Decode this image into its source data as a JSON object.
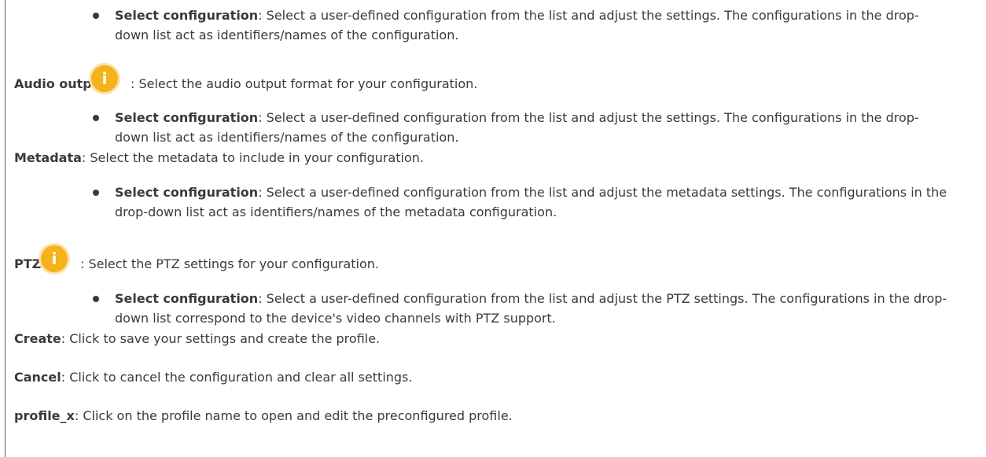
{
  "sections": {
    "audio_output_top_bullet": {
      "term": "Select configuration",
      "text": ": Select a user-defined configuration from the list and adjust the settings. The configurations in the drop-down list act as identifiers/names of the configuration."
    },
    "audio_output": {
      "term": "Audio output",
      "text": ": Select the audio output format for your configuration.",
      "icon": "info-icon"
    },
    "audio_output_bullet": {
      "term": "Select configuration",
      "text": ": Select a user-defined configuration from the list and adjust the settings. The configurations in the drop-down list act as identifiers/names of the configuration."
    },
    "metadata": {
      "term": "Metadata",
      "text": ": Select the metadata to include in your configuration."
    },
    "metadata_bullet": {
      "term": "Select configuration",
      "text": ": Select a user-defined configuration from the list and adjust the metadata settings. The configurations in the drop-down list act as identifiers/names of the metadata configuration."
    },
    "ptz": {
      "term": "PTZ",
      "text": ": Select the PTZ settings for your configuration.",
      "icon": "info-icon"
    },
    "ptz_bullet": {
      "term": "Select configuration",
      "text": ": Select a user-defined configuration from the list and adjust the PTZ settings. The configurations in the drop-down list correspond to the device's video channels with PTZ support."
    },
    "create": {
      "term": "Create",
      "text": ": Click to save your settings and create the profile."
    },
    "cancel": {
      "term": "Cancel",
      "text": ": Click to cancel the configuration and clear all settings."
    },
    "profile_x": {
      "term": "profile_x",
      "text": ": Click on the profile name to open and edit the preconfigured profile."
    }
  },
  "icon_glyph": "i",
  "colors": {
    "text": "#3a3a3a",
    "info_icon": "#f5b21a",
    "info_icon_halo": "#fbe3a6"
  }
}
